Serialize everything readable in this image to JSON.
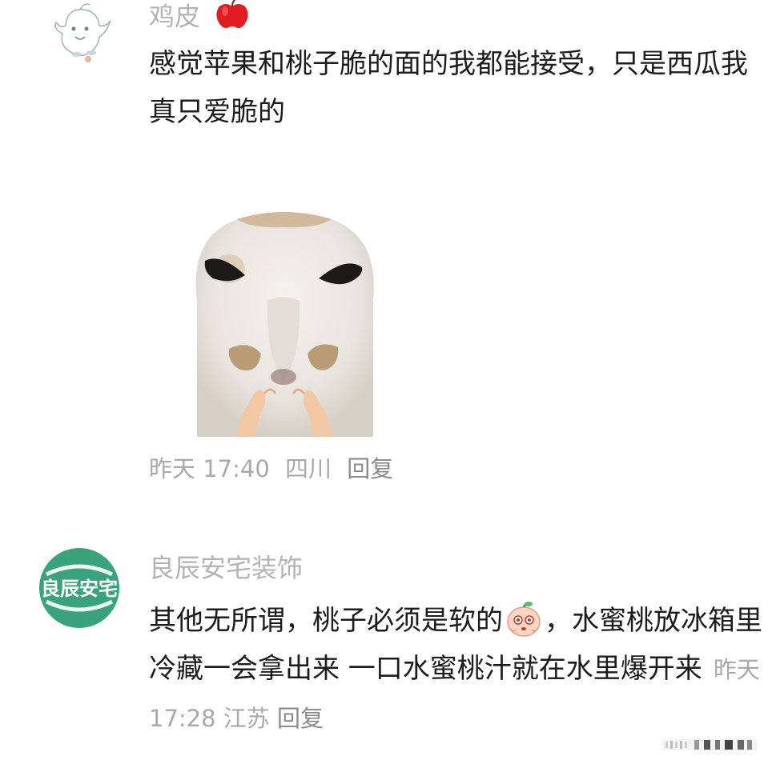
{
  "comments": [
    {
      "username": "鸡皮",
      "username_badge": "apple-icon",
      "content": "感觉苹果和桃子脆的面的我都能接受，只是西瓜我真只爱脆的",
      "sticker": "cat-meme-sticker",
      "meta": {
        "time": "昨天 17:40",
        "location": "四川",
        "reply": "回复"
      }
    },
    {
      "username": "良辰安宅装饰",
      "avatar_text": "良辰安宅",
      "content_before_emoji": "其他无所谓，桃子必须是软的",
      "emoji": "peach-face-emoji",
      "content_after_emoji": "，水蜜桃放冰箱里冷藏一会拿出来 一口水蜜桃汁就在水里爆开来",
      "meta": {
        "time": "昨天 17:28",
        "location": "江苏",
        "reply": "回复"
      }
    }
  ],
  "colors": {
    "username": "#b3b3b3",
    "meta": "#a9a9a9",
    "avatar_green": "#3aa27d"
  }
}
